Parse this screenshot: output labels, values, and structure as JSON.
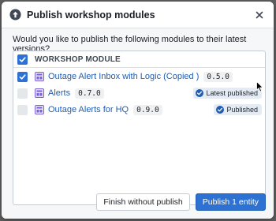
{
  "dialog": {
    "title": "Publish workshop modules",
    "close_icon": "close-icon",
    "header_icon": "upload-arrow-icon"
  },
  "question": "Would you like to publish the following modules to their latest versions?",
  "table": {
    "header_label": "WORKSHOP MODULE",
    "header_checked": true,
    "rows": [
      {
        "name": "Outage Alert Inbox with Logic (Copied )",
        "version": "0.5.0",
        "checked": true,
        "tag": ""
      },
      {
        "name": "Alerts",
        "version": "0.7.0",
        "checked": false,
        "tag": "Latest published"
      },
      {
        "name": "Outage Alerts for HQ",
        "version": "0.9.0",
        "checked": false,
        "tag": "Published"
      }
    ]
  },
  "footer": {
    "secondary_label": "Finish without publish",
    "primary_label": "Publish 1 entity"
  },
  "colors": {
    "accent": "#2d72d2",
    "link": "#215db0",
    "overlay": "#5f5f5f"
  }
}
